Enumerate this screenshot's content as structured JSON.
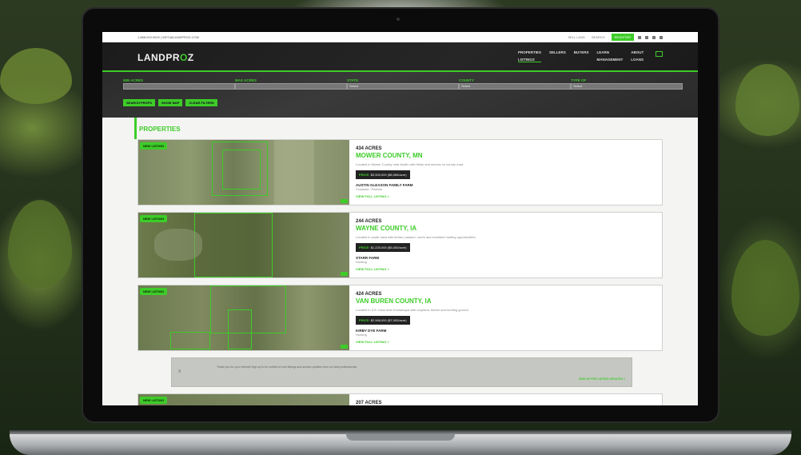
{
  "topbar": {
    "contact": "1.888.000.0000 | INFO@LANDPROZ.COM",
    "links": [
      "SELL LAND",
      "SEARCH"
    ],
    "highlight": "REGISTER"
  },
  "nav": {
    "logo_main": "LANDPR",
    "logo_accent": "O",
    "logo_end": "Z",
    "links": [
      "PROPERTIES",
      "SELLERS",
      "BUYERS",
      "LEARN",
      "ABOUT",
      "LISTINGS",
      "",
      "",
      "MANAGEMENT",
      "LOANS"
    ]
  },
  "filters": {
    "fields": [
      {
        "label": "MIN ACRES",
        "value": ""
      },
      {
        "label": "MAX ACRES",
        "value": ""
      },
      {
        "label": "STATE",
        "value": "Select"
      },
      {
        "label": "COUNTY",
        "value": "Select"
      },
      {
        "label": "TYPE OF",
        "value": "Select"
      }
    ],
    "buttons": [
      "SEARCH PROPS",
      "SHOW MAP",
      "CLEAR FILTERS"
    ]
  },
  "section_title": "PROPERTIES",
  "listings": [
    {
      "badge": "NEW LISTING",
      "acres": "434 ACRES",
      "county": "MOWER COUNTY, MN",
      "desc": "Located in Mower County near Austin with fields and access on county road.",
      "price_label": "PRICE:",
      "price": "$3,500,000 ($8,065/acre)",
      "farm_name": "AUSTIN GLEASON FAMILY FARM",
      "farm_type": "Cropland / Pasture",
      "more": "VIEW FULL LISTING >"
    },
    {
      "badge": "NEW LISTING",
      "acres": "244 ACRES",
      "county": "WAYNE COUNTY, IA",
      "desc": "Located in south Iowa with timber, pasture, creek and excellent hunting opportunities.",
      "price_label": "PRICE:",
      "price": "$1,220,000 ($5,000/acre)",
      "farm_name": "STARR FARM",
      "farm_type": "Hunting",
      "more": "VIEW FULL LISTING >"
    },
    {
      "badge": "NEW LISTING",
      "acres": "424 ACRES",
      "county": "VAN BUREN COUNTY, IA",
      "desc": "Located in S.E. Iowa near Keosauqua with cropland, timber and hunting ground.",
      "price_label": "PRICE:",
      "price": "$2,968,000 ($7,000/acre)",
      "farm_name": "KIRBY DYE FARM",
      "farm_type": "Hunting",
      "more": "VIEW FULL LISTING >"
    }
  ],
  "banner": {
    "close": "X",
    "text": "Thank you for your interest! Sign up to be notified of new listings and auction updates from our land professionals.",
    "cta": "SIGN UP FOR LISTING UPDATES >"
  },
  "partial_listing": {
    "badge": "NEW LISTING",
    "acres": "207 ACRES"
  }
}
